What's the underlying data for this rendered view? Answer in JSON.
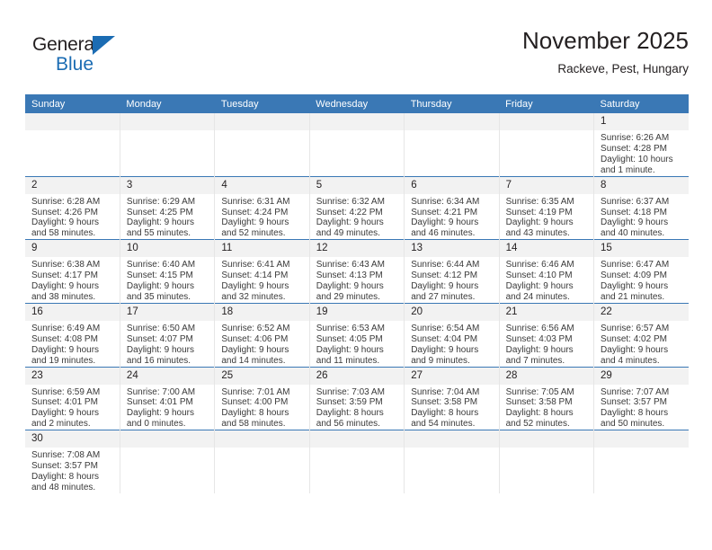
{
  "brand": {
    "name_top": "General",
    "name_bottom": "Blue",
    "accent_color": "#1b6cb3",
    "triangle_icon": "brand-triangle-icon"
  },
  "header": {
    "month_title": "November 2025",
    "location": "Rackeve, Pest, Hungary"
  },
  "calendar": {
    "header_color": "#3a78b5",
    "daynum_band_color": "#f2f2f2",
    "weekday_headers": [
      "Sunday",
      "Monday",
      "Tuesday",
      "Wednesday",
      "Thursday",
      "Friday",
      "Saturday"
    ],
    "weeks": [
      [
        {
          "day": "",
          "empty": true
        },
        {
          "day": "",
          "empty": true
        },
        {
          "day": "",
          "empty": true
        },
        {
          "day": "",
          "empty": true
        },
        {
          "day": "",
          "empty": true
        },
        {
          "day": "",
          "empty": true
        },
        {
          "day": "1",
          "sunrise": "Sunrise: 6:26 AM",
          "sunset": "Sunset: 4:28 PM",
          "daylight_line1": "Daylight: 10 hours",
          "daylight_line2": "and 1 minute."
        }
      ],
      [
        {
          "day": "2",
          "sunrise": "Sunrise: 6:28 AM",
          "sunset": "Sunset: 4:26 PM",
          "daylight_line1": "Daylight: 9 hours",
          "daylight_line2": "and 58 minutes."
        },
        {
          "day": "3",
          "sunrise": "Sunrise: 6:29 AM",
          "sunset": "Sunset: 4:25 PM",
          "daylight_line1": "Daylight: 9 hours",
          "daylight_line2": "and 55 minutes."
        },
        {
          "day": "4",
          "sunrise": "Sunrise: 6:31 AM",
          "sunset": "Sunset: 4:24 PM",
          "daylight_line1": "Daylight: 9 hours",
          "daylight_line2": "and 52 minutes."
        },
        {
          "day": "5",
          "sunrise": "Sunrise: 6:32 AM",
          "sunset": "Sunset: 4:22 PM",
          "daylight_line1": "Daylight: 9 hours",
          "daylight_line2": "and 49 minutes."
        },
        {
          "day": "6",
          "sunrise": "Sunrise: 6:34 AM",
          "sunset": "Sunset: 4:21 PM",
          "daylight_line1": "Daylight: 9 hours",
          "daylight_line2": "and 46 minutes."
        },
        {
          "day": "7",
          "sunrise": "Sunrise: 6:35 AM",
          "sunset": "Sunset: 4:19 PM",
          "daylight_line1": "Daylight: 9 hours",
          "daylight_line2": "and 43 minutes."
        },
        {
          "day": "8",
          "sunrise": "Sunrise: 6:37 AM",
          "sunset": "Sunset: 4:18 PM",
          "daylight_line1": "Daylight: 9 hours",
          "daylight_line2": "and 40 minutes."
        }
      ],
      [
        {
          "day": "9",
          "sunrise": "Sunrise: 6:38 AM",
          "sunset": "Sunset: 4:17 PM",
          "daylight_line1": "Daylight: 9 hours",
          "daylight_line2": "and 38 minutes."
        },
        {
          "day": "10",
          "sunrise": "Sunrise: 6:40 AM",
          "sunset": "Sunset: 4:15 PM",
          "daylight_line1": "Daylight: 9 hours",
          "daylight_line2": "and 35 minutes."
        },
        {
          "day": "11",
          "sunrise": "Sunrise: 6:41 AM",
          "sunset": "Sunset: 4:14 PM",
          "daylight_line1": "Daylight: 9 hours",
          "daylight_line2": "and 32 minutes."
        },
        {
          "day": "12",
          "sunrise": "Sunrise: 6:43 AM",
          "sunset": "Sunset: 4:13 PM",
          "daylight_line1": "Daylight: 9 hours",
          "daylight_line2": "and 29 minutes."
        },
        {
          "day": "13",
          "sunrise": "Sunrise: 6:44 AM",
          "sunset": "Sunset: 4:12 PM",
          "daylight_line1": "Daylight: 9 hours",
          "daylight_line2": "and 27 minutes."
        },
        {
          "day": "14",
          "sunrise": "Sunrise: 6:46 AM",
          "sunset": "Sunset: 4:10 PM",
          "daylight_line1": "Daylight: 9 hours",
          "daylight_line2": "and 24 minutes."
        },
        {
          "day": "15",
          "sunrise": "Sunrise: 6:47 AM",
          "sunset": "Sunset: 4:09 PM",
          "daylight_line1": "Daylight: 9 hours",
          "daylight_line2": "and 21 minutes."
        }
      ],
      [
        {
          "day": "16",
          "sunrise": "Sunrise: 6:49 AM",
          "sunset": "Sunset: 4:08 PM",
          "daylight_line1": "Daylight: 9 hours",
          "daylight_line2": "and 19 minutes."
        },
        {
          "day": "17",
          "sunrise": "Sunrise: 6:50 AM",
          "sunset": "Sunset: 4:07 PM",
          "daylight_line1": "Daylight: 9 hours",
          "daylight_line2": "and 16 minutes."
        },
        {
          "day": "18",
          "sunrise": "Sunrise: 6:52 AM",
          "sunset": "Sunset: 4:06 PM",
          "daylight_line1": "Daylight: 9 hours",
          "daylight_line2": "and 14 minutes."
        },
        {
          "day": "19",
          "sunrise": "Sunrise: 6:53 AM",
          "sunset": "Sunset: 4:05 PM",
          "daylight_line1": "Daylight: 9 hours",
          "daylight_line2": "and 11 minutes."
        },
        {
          "day": "20",
          "sunrise": "Sunrise: 6:54 AM",
          "sunset": "Sunset: 4:04 PM",
          "daylight_line1": "Daylight: 9 hours",
          "daylight_line2": "and 9 minutes."
        },
        {
          "day": "21",
          "sunrise": "Sunrise: 6:56 AM",
          "sunset": "Sunset: 4:03 PM",
          "daylight_line1": "Daylight: 9 hours",
          "daylight_line2": "and 7 minutes."
        },
        {
          "day": "22",
          "sunrise": "Sunrise: 6:57 AM",
          "sunset": "Sunset: 4:02 PM",
          "daylight_line1": "Daylight: 9 hours",
          "daylight_line2": "and 4 minutes."
        }
      ],
      [
        {
          "day": "23",
          "sunrise": "Sunrise: 6:59 AM",
          "sunset": "Sunset: 4:01 PM",
          "daylight_line1": "Daylight: 9 hours",
          "daylight_line2": "and 2 minutes."
        },
        {
          "day": "24",
          "sunrise": "Sunrise: 7:00 AM",
          "sunset": "Sunset: 4:01 PM",
          "daylight_line1": "Daylight: 9 hours",
          "daylight_line2": "and 0 minutes."
        },
        {
          "day": "25",
          "sunrise": "Sunrise: 7:01 AM",
          "sunset": "Sunset: 4:00 PM",
          "daylight_line1": "Daylight: 8 hours",
          "daylight_line2": "and 58 minutes."
        },
        {
          "day": "26",
          "sunrise": "Sunrise: 7:03 AM",
          "sunset": "Sunset: 3:59 PM",
          "daylight_line1": "Daylight: 8 hours",
          "daylight_line2": "and 56 minutes."
        },
        {
          "day": "27",
          "sunrise": "Sunrise: 7:04 AM",
          "sunset": "Sunset: 3:58 PM",
          "daylight_line1": "Daylight: 8 hours",
          "daylight_line2": "and 54 minutes."
        },
        {
          "day": "28",
          "sunrise": "Sunrise: 7:05 AM",
          "sunset": "Sunset: 3:58 PM",
          "daylight_line1": "Daylight: 8 hours",
          "daylight_line2": "and 52 minutes."
        },
        {
          "day": "29",
          "sunrise": "Sunrise: 7:07 AM",
          "sunset": "Sunset: 3:57 PM",
          "daylight_line1": "Daylight: 8 hours",
          "daylight_line2": "and 50 minutes."
        }
      ],
      [
        {
          "day": "30",
          "sunrise": "Sunrise: 7:08 AM",
          "sunset": "Sunset: 3:57 PM",
          "daylight_line1": "Daylight: 8 hours",
          "daylight_line2": "and 48 minutes."
        },
        {
          "day": "",
          "empty": true
        },
        {
          "day": "",
          "empty": true
        },
        {
          "day": "",
          "empty": true
        },
        {
          "day": "",
          "empty": true
        },
        {
          "day": "",
          "empty": true
        },
        {
          "day": "",
          "empty": true
        }
      ]
    ]
  }
}
